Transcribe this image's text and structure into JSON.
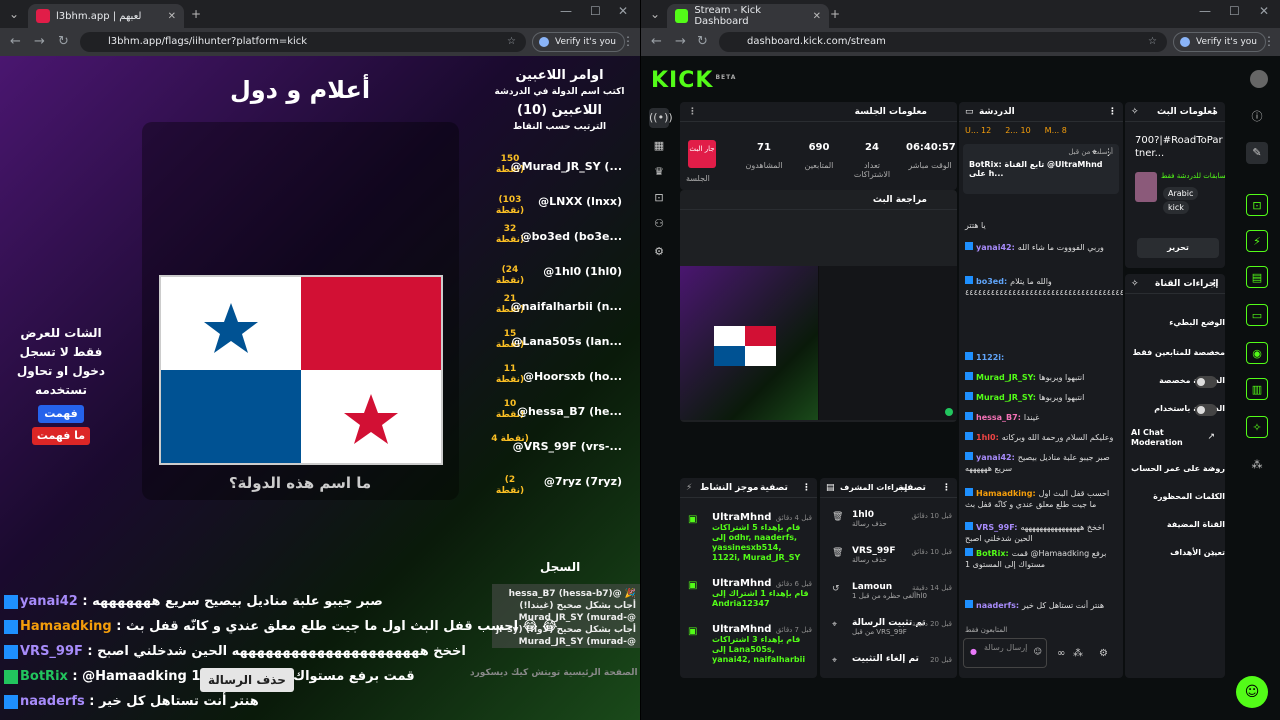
{
  "left_window": {
    "tab_title": "l3bhm.app | لعبهم",
    "url": "l3bhm.app/flags/iihunter?platform=kick",
    "verify": "Verify it's you",
    "game": {
      "title": "أعلام و دول",
      "question": "ما اسم هذه الدولة؟",
      "notice": "الشات للعرض فقط لا تسجل دخول او تحاول تستخدمه",
      "btn_understood": "فهمت",
      "btn_not_understood": "ما فهمت",
      "commands_header": "اوامر اللاعبين",
      "commands_sub": "اكتب اسم الدولة في الدردشة",
      "players_header": "اللاعبين (10)",
      "players_sub": "الترتيب حسب النقاط",
      "players": [
        {
          "points": "150 نقطة)",
          "name": "@Murad_JR_SY (..."
        },
        {
          "points": "(103 نقطة)",
          "name": "@LNXX (lnxx)"
        },
        {
          "points": "32 نقطة)",
          "name": "@bo3ed (bo3e..."
        },
        {
          "points": "(24 نقطة)",
          "name": "@1hl0 (1hl0)"
        },
        {
          "points": "21 نقطة)",
          "name": "@naifalharbii (n..."
        },
        {
          "points": "15 نقطة)",
          "name": "@Lana505s (lan..."
        },
        {
          "points": "11 نقطة)",
          "name": "@Hoorsxb (ho..."
        },
        {
          "points": "10 نقطة)",
          "name": "@hessa_B7 (he..."
        },
        {
          "points": "4 نقطة)",
          "name": "@VRS_99F (vrs-..."
        },
        {
          "points": "(2 نقطة)",
          "name": "@7ryz (7ryz)"
        }
      ],
      "log_header": "السجل",
      "log_lines": [
        "hessa_B7 (hessa-b7)@ 🎉",
        "أجاب بشكل صحيح (غيندا!)",
        "Murad_JR_SY (murad-@",
        "jr-sy) أجاب بشكل صحيح (لاوا!)",
        "Murad_JR_SY (murad-@"
      ],
      "streamer_tabs": "الصفحة الرئيسية  تويتش  كيك  ديسكورد"
    },
    "chat": [
      {
        "user": "yanai42",
        "color": "#a78bfa",
        "text": " : صبر جيبو علبة مناديل بيصيح سريع هههههههه"
      },
      {
        "user": "Hamaadking",
        "color": "#f59e0b",
        "text": " : احسب قفل البث اول ما جيت طلع معلق عندي و كانّه قفل بث 😂 😂"
      },
      {
        "user": "VRS_99F",
        "color": "#a78bfa",
        "text": " : اخخخ ههههههههههههههههههههههه الحين شدخلني اصبح"
      },
      {
        "user": "BotRix",
        "color": "#22c55e",
        "text": " : @Hamaadking 1 قمت برفع مستواك إلى المستوى"
      },
      {
        "user": "naaderfs",
        "color": "#a78bfa",
        "text": " : هنتر أنت تستاهل كل خير"
      }
    ],
    "tooltip": "حذف الرسالة"
  },
  "right_window": {
    "tab_title": "Stream - Kick Dashboard",
    "url": "dashboard.kick.com/stream",
    "verify": "Verify it's you",
    "logo": "KICK",
    "logo_sup": "BETA",
    "session": {
      "header": "معلومات الجلسة",
      "live_badge": "جار البث",
      "live_label": "الجلسة",
      "stats": [
        {
          "value": "71",
          "label": "المشاهدون"
        },
        {
          "value": "690",
          "label": "المتابعين"
        },
        {
          "value": "24",
          "label": "تعداد الاشتراكات"
        },
        {
          "value": "06:40:57",
          "label": "الوقت مباشر"
        }
      ]
    },
    "preview_header": "مراجعة البث",
    "activity": {
      "header": "موجز النشاط",
      "filter": "تصفية",
      "items": [
        {
          "name": "UltraMhnd",
          "time": "قبل 4 دقائق",
          "desc": "قام بإهداء 5 اشتراكات إلى odhr, naaderfs, yassinesxb514, 1122i, Murad_JR_SY"
        },
        {
          "name": "UltraMhnd",
          "time": "قبل 6 دقائق",
          "desc": "قام بإهداء 1 اشتراك إلى Andria12347"
        },
        {
          "name": "UltraMhnd",
          "time": "قبل 7 دقائق",
          "desc": "قام بإهداء 3 اشتراكات إلى Lana505s, yanai42, naifalharbii"
        }
      ]
    },
    "mod": {
      "header": "إجراءات المشرف",
      "filter": "تصفية",
      "items": [
        {
          "name": "1hl0",
          "time": "قبل 10 دقائق",
          "desc": "حذف رسالة"
        },
        {
          "name": "VRS_99F",
          "time": "قبل 10 دقائق",
          "desc": "حذف رسالة"
        },
        {
          "name": "Lamoun",
          "time": "قبل 14 دقيقة",
          "desc": "ألغى حظره من قبل 1hl0"
        },
        {
          "name": "تم تثبيت الرسالة",
          "time": "قبل 20 دقيقة",
          "desc": "من قبل VRS_99F"
        },
        {
          "name": "تم إلغاء التثبيت",
          "time": "قبل 20",
          "desc": ""
        }
      ]
    },
    "chat": {
      "header": "الدردشة",
      "counts": [
        "U... 12",
        "2... 10",
        "M... 8"
      ],
      "pinned_by": "أرسلت من قبل",
      "pinned": "BotRix: تابع القناة @UltraMhnd على h...",
      "messages": [
        {
          "user": "",
          "color": "#ddd",
          "text": "يا هتتر"
        },
        {
          "user": "yanai42:",
          "color": "#a78bfa",
          "text": "وربي الفوووت ما شاء الله"
        },
        {
          "user": "bo3ed:",
          "color": "#60a5fa",
          "text": "والله ما يتلام ٤٤٤٤٤٤٤٤٤٤٤٤٤٤٤٤٤٤٤٤٤٤٤٤٤٤٤٤٤٤٤٤٤٤٤٤٤٤٤٤٤"
        },
        {
          "user": "1122i:",
          "color": "#60a5fa",
          "text": ""
        },
        {
          "user": "Murad_JR_SY:",
          "color": "#53fc18",
          "text": "انتبهوا ويربوها"
        },
        {
          "user": "Murad_JR_SY:",
          "color": "#53fc18",
          "text": "انتبهوا ويربوها"
        },
        {
          "user": "hessa_B7:",
          "color": "#f472b6",
          "text": "غيندا"
        },
        {
          "user": "1hl0:",
          "color": "#ef4444",
          "text": "وعليكم السلام ورحمة الله وبركاته"
        },
        {
          "user": "yanai42:",
          "color": "#a78bfa",
          "text": "صبر جيبو علبة مناديل بيصيح سريع ههههههه"
        },
        {
          "user": "Hamaadking:",
          "color": "#f59e0b",
          "text": "احسب قفل البث اول ما جيت طلع معلق عندي و كانّه قفل بث"
        },
        {
          "user": "VRS_99F:",
          "color": "#a78bfa",
          "text": "اخخخ ههههههههههههههههه الحين شدخلني اصبح"
        },
        {
          "user": "BotRix:",
          "color": "#53fc18",
          "text": "قمت @Hamaadking برفع مستواك إلى المستوى 1"
        },
        {
          "user": "naaderfs:",
          "color": "#a78bfa",
          "text": "هنتر أنت تستاهل كل خير"
        }
      ],
      "followers_only": "المتابعون فقط",
      "placeholder": "إرسال رسالة"
    },
    "stream_info": {
      "header": "معلومات البث",
      "title": "700?|#RoadToPartner...",
      "desc": "مسابقات للدردشة فقط",
      "tags": [
        "Arabic",
        "kick"
      ],
      "edit": "تحرير"
    },
    "channel_actions": {
      "header": "إجراءات القناة",
      "items": [
        {
          "label": "الوضع البطيء",
          "ctl": "chev"
        },
        {
          "label": "مخصصة للمتابعين فقط",
          "ctl": "chev"
        },
        {
          "label": "الدردشة مخصصة",
          "ctl": "toggle"
        },
        {
          "label": "الدردشة باستخدام",
          "ctl": "toggle"
        },
        {
          "label": "AI Chat Moderation",
          "ctl": "ext"
        },
        {
          "label": "روضة على عمر الحساب",
          "ctl": "chev"
        },
        {
          "label": "الكلمات المحظورة",
          "ctl": "chev"
        },
        {
          "label": "القناة المضيفة",
          "ctl": ""
        },
        {
          "label": "تعيين الأهداف",
          "ctl": "chev"
        }
      ]
    }
  }
}
